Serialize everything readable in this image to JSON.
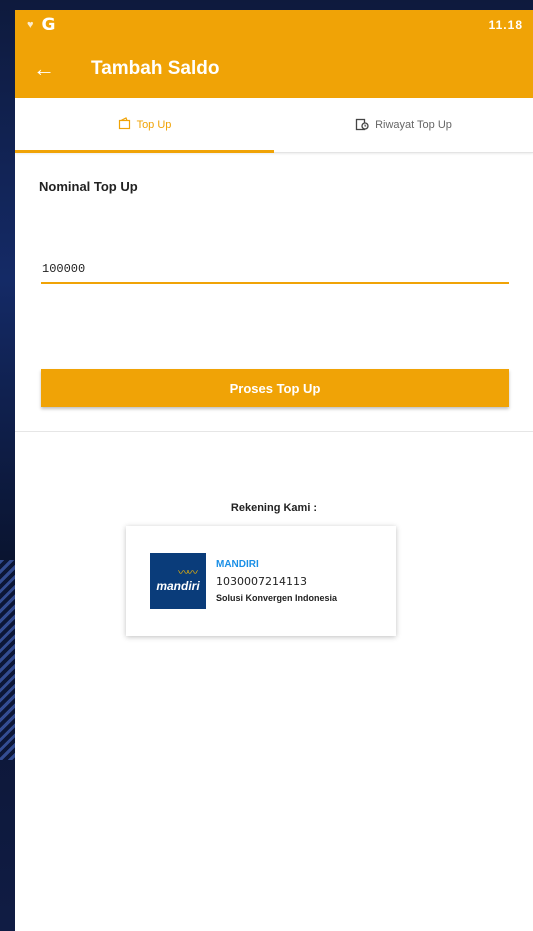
{
  "status_bar": {
    "time": "11.18",
    "left_icons": [
      "heart-icon",
      "google-icon"
    ]
  },
  "app_bar": {
    "title": "Tambah Saldo",
    "back_icon": "arrow-left-icon"
  },
  "tabs": [
    {
      "label": "Top Up",
      "icon": "wallet-icon",
      "active": true
    },
    {
      "label": "Riwayat Top Up",
      "icon": "history-icon",
      "active": false
    }
  ],
  "form": {
    "label": "Nominal Top Up",
    "value": "100000",
    "submit_label": "Proses Top Up"
  },
  "rekening": {
    "title": "Rekening Kami :",
    "bank_logo_text": "mandiri",
    "bank_name": "MANDIRI",
    "account_number": "1030007214113",
    "account_holder": "Solusi Konvergen Indonesia"
  },
  "colors": {
    "primary": "#f0a306",
    "bank_name": "#1a8fe6",
    "bank_logo_bg": "#0a3c7a"
  }
}
